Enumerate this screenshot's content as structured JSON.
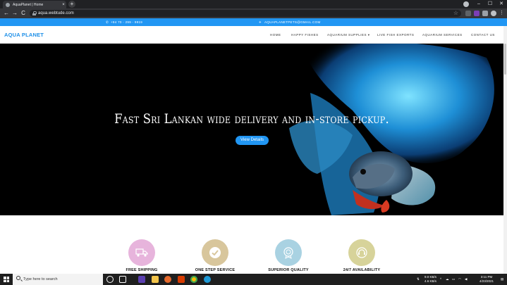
{
  "browser": {
    "tab_title": "AquaPlanet | Home",
    "tab_close": "×",
    "new_tab": "+",
    "url": "aqua.webtude.com",
    "back": "←",
    "forward": "→",
    "reload": "C",
    "window_controls": [
      "–",
      "☐",
      "✕"
    ]
  },
  "topbar": {
    "phone": "+94 70 - 299 - 9919",
    "email": "AQUAPLANETPETS@GMAIL.COM"
  },
  "navbar": {
    "brand": "AQUA PLANET",
    "links": [
      "HOME",
      "HAPPY FISHES",
      "AQUARIUM SUPPLIES ▾",
      "LIVE FISH EXPORTS",
      "AQUARIUM SERVICES",
      "CONTACT US"
    ]
  },
  "hero": {
    "title": "Fast Sri Lankan wide delivery and in-store pickup.",
    "button": "View Details"
  },
  "features": [
    {
      "label": "FREE SHIPPING",
      "icon": "truck-icon",
      "color": "#e7b4dc"
    },
    {
      "label": "ONE STEP SERVICE",
      "icon": "check-icon",
      "color": "#d8c69c"
    },
    {
      "label": "SUPERIOR QUALITY",
      "icon": "medal-icon",
      "color": "#a9d2e2"
    },
    {
      "label": "24/7 AVAILABILITY",
      "icon": "support-icon",
      "color": "#d7d39a"
    }
  ],
  "taskbar": {
    "search_placeholder": "Type here to search",
    "net_up": "9.0 KB/s",
    "net_down": "4.6 KB/s",
    "time": "3:11 PM",
    "date": "4/23/2021"
  },
  "colors": {
    "accent": "#2196f3",
    "brand": "#1d8fe8"
  }
}
